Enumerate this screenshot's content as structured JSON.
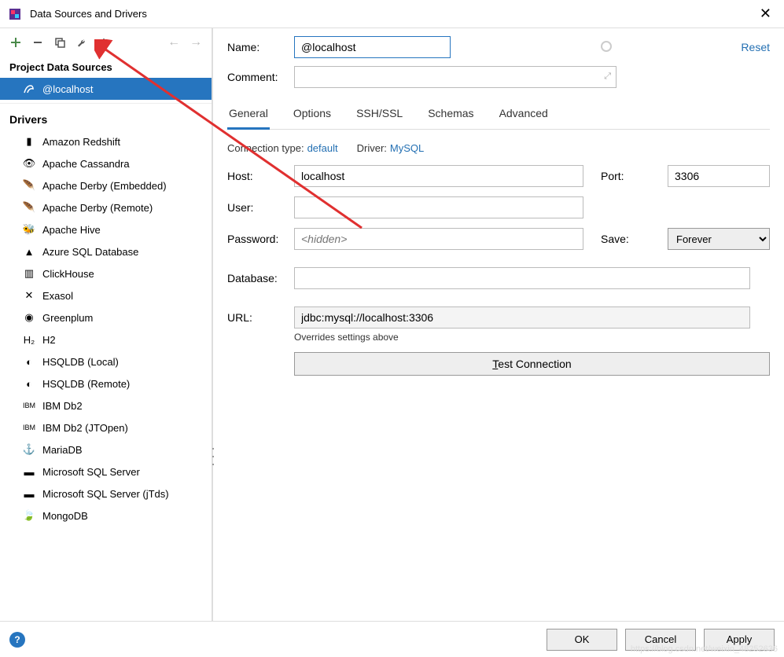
{
  "window": {
    "title": "Data Sources and Drivers"
  },
  "sidebar": {
    "section_project": "Project Data Sources",
    "datasource": {
      "label": "@localhost"
    },
    "section_drivers": "Drivers",
    "drivers": [
      "Amazon Redshift",
      "Apache Cassandra",
      "Apache Derby (Embedded)",
      "Apache Derby (Remote)",
      "Apache Hive",
      "Azure SQL Database",
      "ClickHouse",
      "Exasol",
      "Greenplum",
      "H2",
      "HSQLDB (Local)",
      "HSQLDB (Remote)",
      "IBM Db2",
      "IBM Db2 (JTOpen)",
      "MariaDB",
      "Microsoft SQL Server",
      "Microsoft SQL Server (jTds)",
      "MongoDB"
    ]
  },
  "form": {
    "name_label": "Name:",
    "name_value": "@localhost",
    "comment_label": "Comment:",
    "reset": "Reset",
    "tabs": [
      "General",
      "Options",
      "SSH/SSL",
      "Schemas",
      "Advanced"
    ],
    "conn_type_label": "Connection type:",
    "conn_type_value": "default",
    "driver_label": "Driver:",
    "driver_value": "MySQL",
    "host_label": "Host:",
    "host_value": "localhost",
    "port_label": "Port:",
    "port_value": "3306",
    "user_label": "User:",
    "user_value": "",
    "password_label": "Password:",
    "password_placeholder": "<hidden>",
    "save_label": "Save:",
    "save_value": "Forever",
    "database_label": "Database:",
    "database_value": "",
    "url_label": "URL:",
    "url_value": "jdbc:mysql://localhost:3306",
    "url_note": "Overrides settings above",
    "test_btn_prefix": "T",
    "test_btn_rest": "est Connection"
  },
  "footer": {
    "ok": "OK",
    "cancel": "Cancel",
    "apply": "Apply"
  },
  "watermark": "https://blog.csdn.net/weixin_48252636"
}
